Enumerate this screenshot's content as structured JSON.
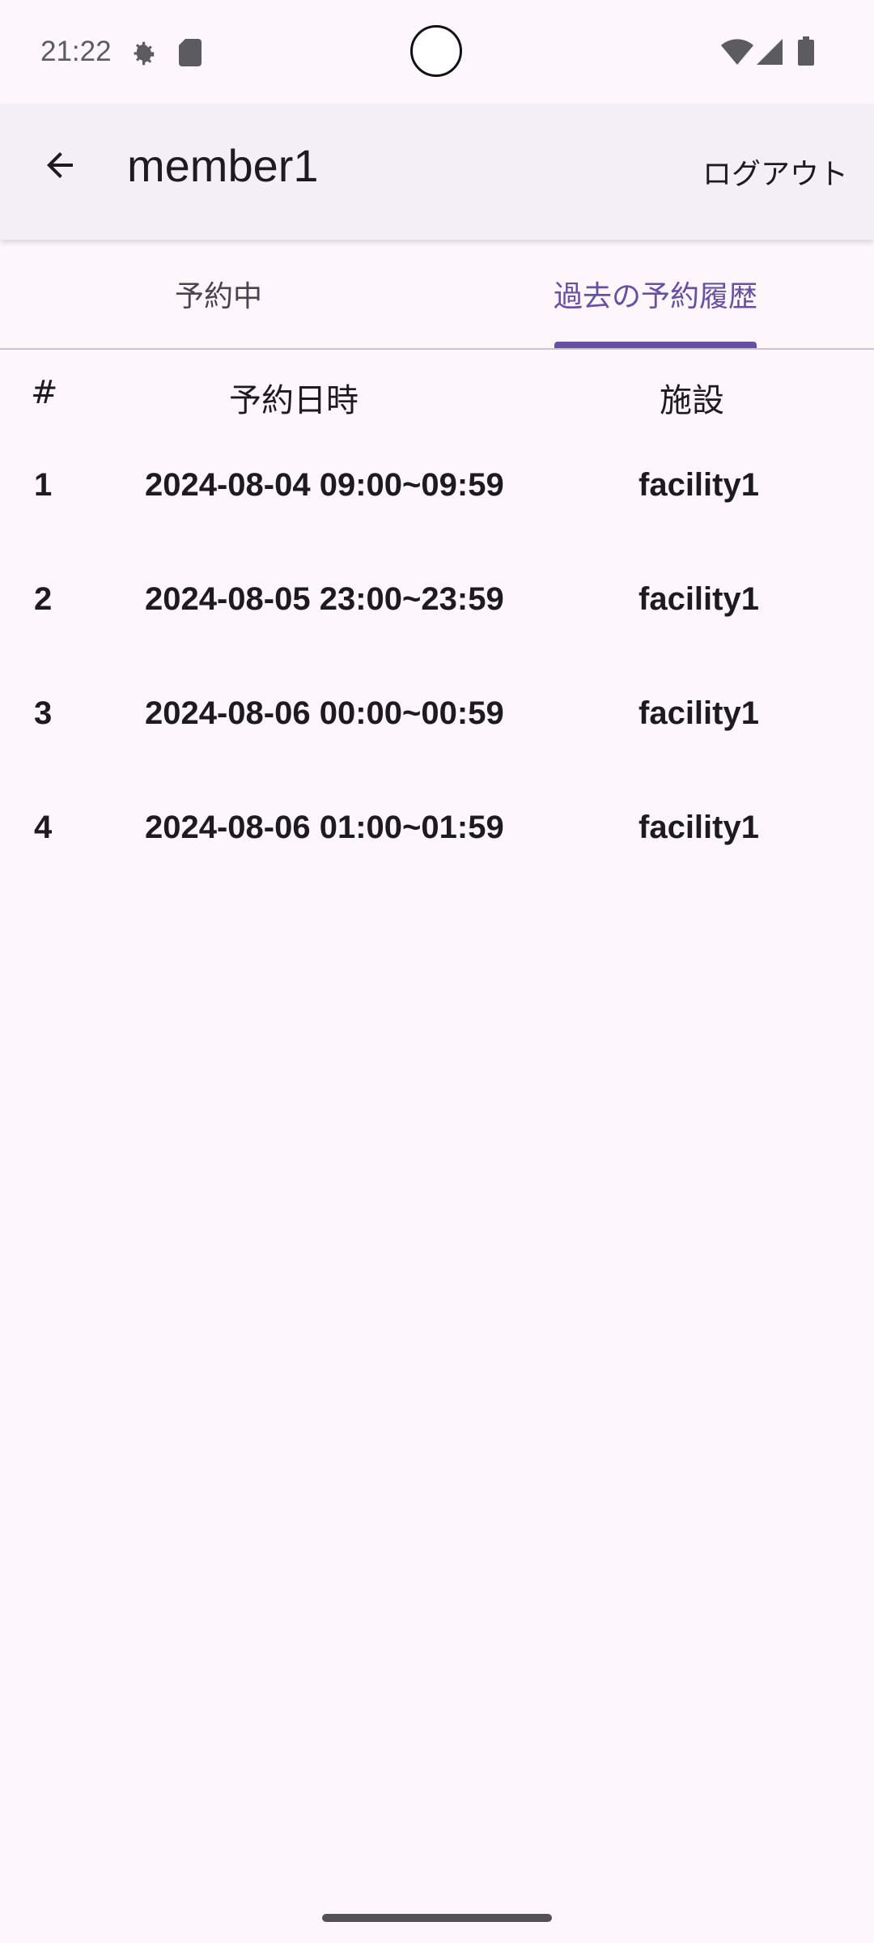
{
  "status_bar": {
    "time": "21:22",
    "icons": [
      "gear-icon",
      "sd-card-icon",
      "wifi-icon",
      "signal-icon",
      "battery-icon"
    ]
  },
  "app_bar": {
    "back_icon": "arrow-left-icon",
    "title": "member1",
    "logout_label": "ログアウト"
  },
  "tabs": [
    {
      "label": "予約中",
      "selected": false
    },
    {
      "label": "過去の予約履歴",
      "selected": true
    }
  ],
  "table": {
    "headers": {
      "num": "#",
      "datetime": "予約日時",
      "facility": "施設"
    },
    "rows": [
      {
        "num": "1",
        "datetime": "2024-08-04 09:00~09:59",
        "facility": "facility1"
      },
      {
        "num": "2",
        "datetime": "2024-08-05 23:00~23:59",
        "facility": "facility1"
      },
      {
        "num": "3",
        "datetime": "2024-08-06 00:00~00:59",
        "facility": "facility1"
      },
      {
        "num": "4",
        "datetime": "2024-08-06 01:00~01:59",
        "facility": "facility1"
      }
    ]
  },
  "colors": {
    "background": "#fdf7fc",
    "app_bar": "#f3eff6",
    "accent": "#6750a4",
    "text": "#1d1b20"
  }
}
